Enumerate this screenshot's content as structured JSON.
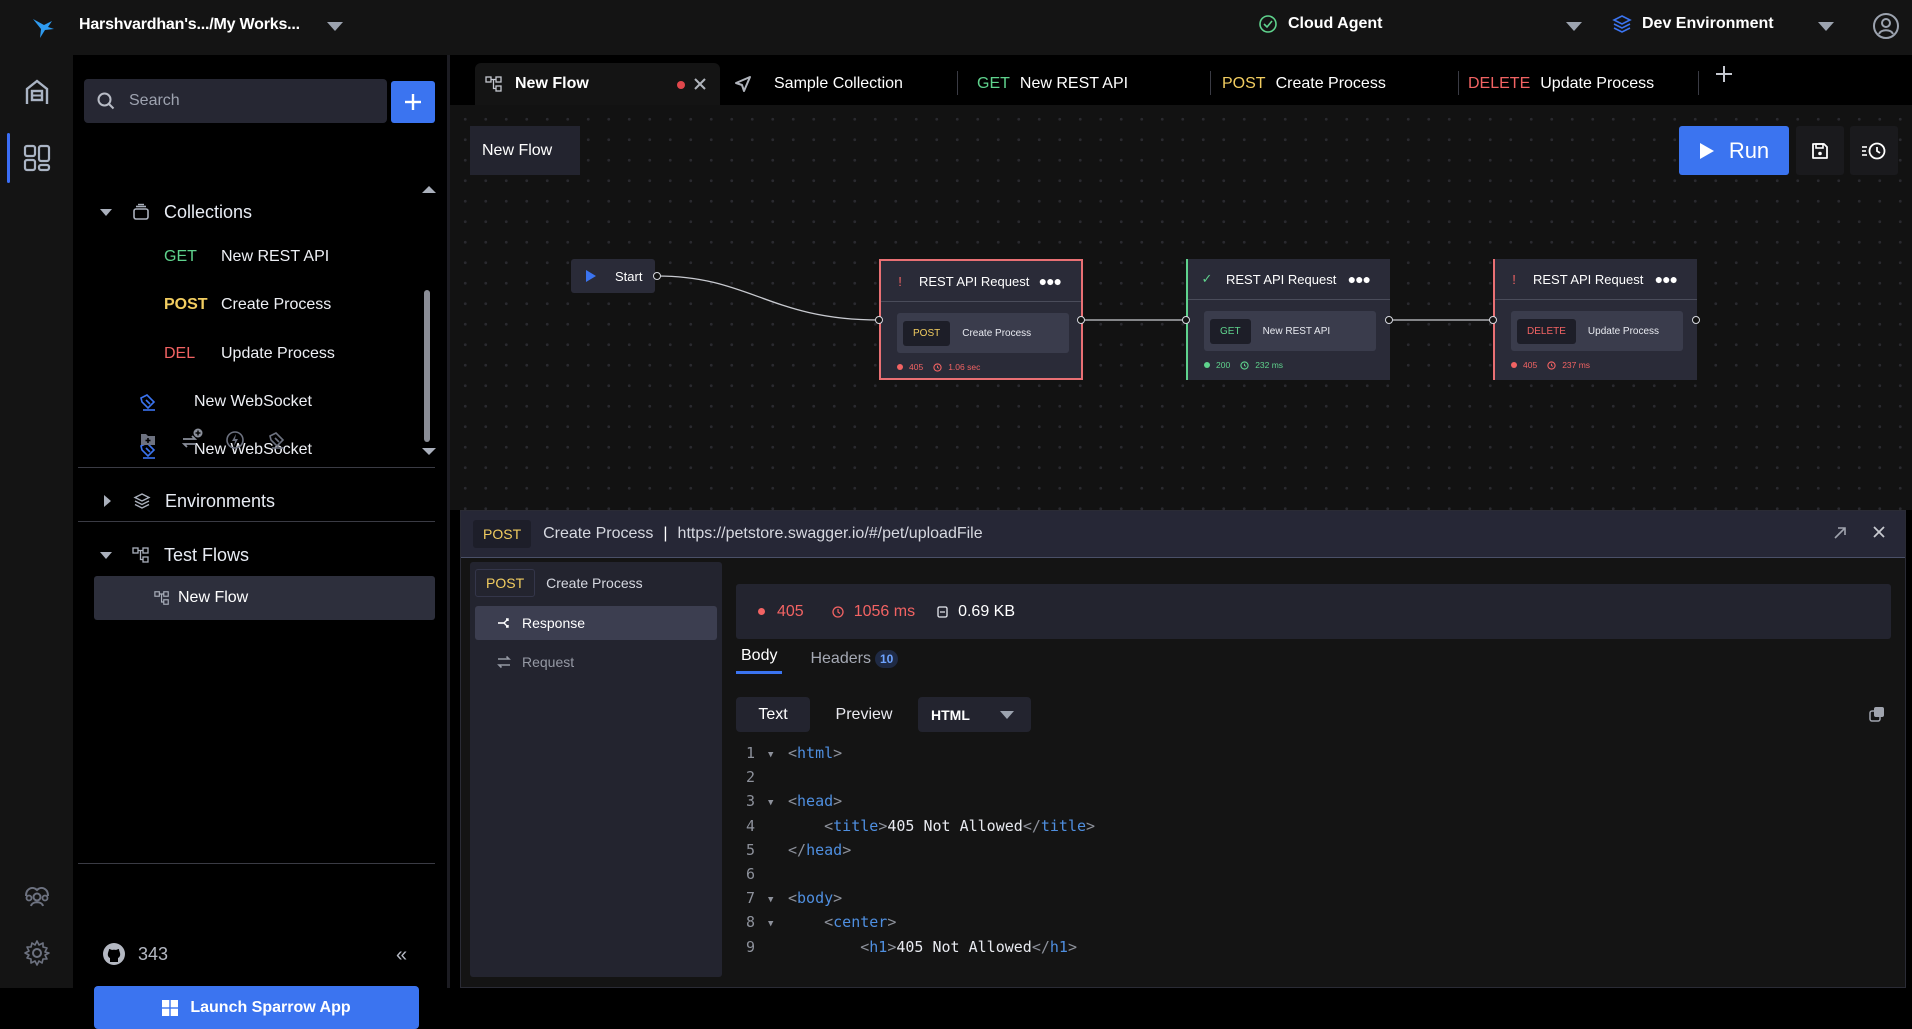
{
  "topbar": {
    "workspace": "Harshvardhan's.../My Works...",
    "agent": "Cloud Agent",
    "environment": "Dev Environment"
  },
  "sidebar": {
    "search_placeholder": "Search",
    "collections_label": "Collections",
    "requests": [
      {
        "method": "GET",
        "name": "New REST API"
      },
      {
        "method": "POST",
        "name": "Create Process"
      },
      {
        "method": "DEL",
        "name": "Update Process"
      }
    ],
    "websockets": [
      {
        "name": "New WebSocket"
      },
      {
        "name": "New WebSocket"
      }
    ],
    "environments_label": "Environments",
    "testflows_label": "Test Flows",
    "flow_item": "New Flow",
    "github_stars": "343",
    "collapse_glyph": "«",
    "launch_label": "Launch Sparrow App"
  },
  "tabs": [
    {
      "method": "",
      "label": "New Flow",
      "active": true,
      "unsaved": true
    },
    {
      "method": "",
      "label": "Sample Collection"
    },
    {
      "method": "GET",
      "label": "New REST API"
    },
    {
      "method": "POST",
      "label": "Create Process"
    },
    {
      "method": "DELETE",
      "label": "Update Process"
    }
  ],
  "canvas": {
    "flow_title": "New Flow",
    "run_label": "Run",
    "start_label": "Start",
    "nodes": [
      {
        "title": "REST API Request",
        "status_icon": "!",
        "method": "POST",
        "request": "Create Process",
        "status": "405",
        "time": "1.06 sec",
        "ok": false
      },
      {
        "title": "REST API Request",
        "status_icon": "✓",
        "method": "GET",
        "request": "New REST API",
        "status": "200",
        "time": "232 ms",
        "ok": true
      },
      {
        "title": "REST API Request",
        "status_icon": "!",
        "method": "DELETE",
        "request": "Update Process",
        "status": "405",
        "time": "237 ms",
        "ok": false
      }
    ]
  },
  "panel": {
    "method": "POST",
    "request_name": "Create Process",
    "separator": "|",
    "url": "https://petstore.swagger.io/#/pet/uploadFile",
    "side_method": "POST",
    "side_name": "Create Process",
    "side_items": [
      "Response",
      "Request"
    ],
    "status_code": "405",
    "duration": "1056 ms",
    "size": "0.69 KB",
    "body_tab": "Body",
    "headers_tab": "Headers",
    "headers_count": "10",
    "text_btn": "Text",
    "preview_btn": "Preview",
    "format": "HTML",
    "code_lines": [
      {
        "n": "1",
        "fold": true
      },
      {
        "n": "2",
        "fold": false
      },
      {
        "n": "3",
        "fold": true
      },
      {
        "n": "4",
        "fold": false
      },
      {
        "n": "5",
        "fold": false
      },
      {
        "n": "6",
        "fold": false
      },
      {
        "n": "7",
        "fold": true
      },
      {
        "n": "8",
        "fold": true
      },
      {
        "n": "9",
        "fold": false
      }
    ],
    "code_text": {
      "title_text": "405 Not Allowed",
      "h1_text": "405 Not Allowed"
    }
  },
  "colors": {
    "accent": "#3b74f0",
    "get": "#5fd38d",
    "post": "#f2cd60",
    "delete": "#f26363",
    "error_border": "#e97074"
  }
}
